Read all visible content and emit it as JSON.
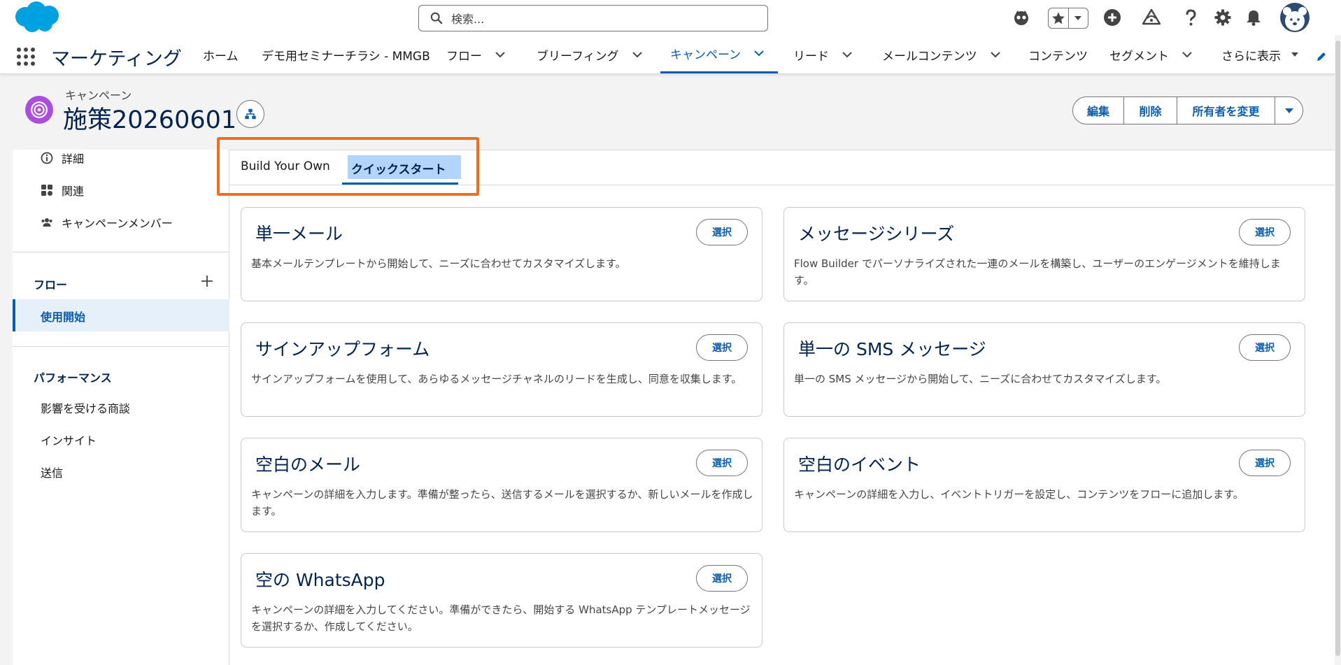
{
  "header": {
    "search_placeholder": "検索..."
  },
  "nav": {
    "app_name": "マーケティング",
    "items": [
      {
        "label": "ホーム",
        "has_menu": false
      },
      {
        "label": "デモ用セミナーチラシ - MMGB",
        "has_menu": false
      },
      {
        "label": "フロー",
        "has_menu": true
      },
      {
        "label": "ブリーフィング",
        "has_menu": true
      },
      {
        "label": "キャンペーン",
        "has_menu": true,
        "active": true
      },
      {
        "label": "リード",
        "has_menu": true
      },
      {
        "label": "メールコンテンツ",
        "has_menu": true
      },
      {
        "label": "コンテンツ",
        "has_menu": false
      },
      {
        "label": "セグメント",
        "has_menu": true
      },
      {
        "label": "さらに表示",
        "has_menu": true
      }
    ]
  },
  "record": {
    "type_label": "キャンペーン",
    "title": "施策20260601",
    "actions": [
      "編集",
      "削除",
      "所有者を変更"
    ]
  },
  "sidebar": {
    "items": [
      "詳細",
      "関連",
      "キャンペーンメンバー"
    ],
    "flow_heading": "フロー",
    "flow_active_item": "使用開始",
    "performance_heading": "パフォーマンス",
    "performance_items": [
      "影響を受ける商談",
      "インサイト",
      "送信"
    ]
  },
  "tabs": {
    "build_your_own": "Build Your Own",
    "quick_start": "クイックスタート",
    "active": "クイックスタート"
  },
  "cards": [
    {
      "title": "単一メール",
      "description": "基本メールテンプレートから開始して、ニーズに合わせてカスタマイズします。",
      "button": "選択"
    },
    {
      "title": "メッセージシリーズ",
      "description": "Flow Builder でパーソナライズされた一連のメールを構築し、ユーザーのエンゲージメントを維持します。",
      "button": "選択"
    },
    {
      "title": "サインアップフォーム",
      "description": "サインアップフォームを使用して、あらゆるメッセージチャネルのリードを生成し、同意を収集します。",
      "button": "選択"
    },
    {
      "title": "単一の SMS メッセージ",
      "description": "単一の SMS メッセージから開始して、ニーズに合わせてカスタマイズします。",
      "button": "選択"
    },
    {
      "title": "空白のメール",
      "description": "キャンペーンの詳細を入力します。準備が整ったら、送信するメールを選択するか、新しいメールを作成します。",
      "button": "選択"
    },
    {
      "title": "空白のイベント",
      "description": "キャンペーンの詳細を入力し、イベントトリガーを設定し、コンテンツをフローに追加します。",
      "button": "選択"
    },
    {
      "title": "空の WhatsApp",
      "description": "キャンペーンの詳細を入力してください。準備ができたら、開始する WhatsApp テンプレートメッセージを選択するか、作成してください。",
      "button": "選択"
    }
  ],
  "colors": {
    "brand_blue": "#0b5cab",
    "title_navy": "#03234d",
    "highlight_orange": "#f26c1a",
    "campaign_icon": "#a94fdb",
    "logo_cloud": "#00a1e0"
  }
}
